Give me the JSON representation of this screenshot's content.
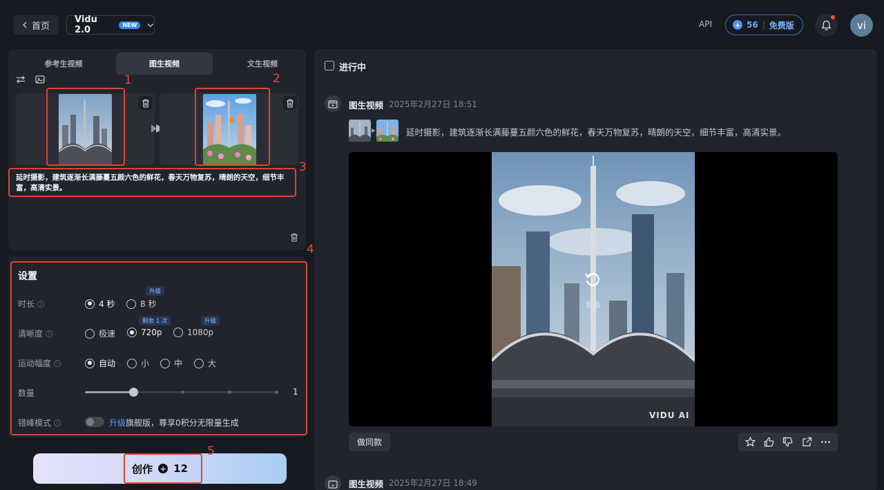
{
  "header": {
    "home_label": "首页",
    "model_name": "Vidu 2.0",
    "new_badge": "NEW",
    "api_label": "API",
    "credits": "56",
    "plan": "免费版",
    "avatar_initials": "vi"
  },
  "upload": {
    "tabs": [
      {
        "label": "参考生视频",
        "active": false
      },
      {
        "label": "图生视频",
        "active": true
      },
      {
        "label": "文生视频",
        "active": false
      }
    ],
    "prompt": "延时摄影，建筑逐渐长满藤蔓五颜六色的鲜花，春天万物复苏，晴朗的天空，细节丰富，高清实景。"
  },
  "annotations": [
    "1",
    "2",
    "3",
    "4",
    "5"
  ],
  "settings": {
    "title": "设置",
    "duration": {
      "label": "时长",
      "options": [
        "4 秒",
        "8 秒"
      ],
      "selected": "4 秒",
      "upgrade_chip": "升级"
    },
    "resolution": {
      "label": "清晰度",
      "options": [
        "极速",
        "720p",
        "1080p"
      ],
      "selected": "720p",
      "remaining_chip": "剩余 1 次",
      "upgrade_chip": "升级"
    },
    "motion": {
      "label": "运动幅度",
      "options": [
        "自动",
        "小",
        "中",
        "大"
      ],
      "selected": "自动"
    },
    "quantity": {
      "label": "数量",
      "value": "1",
      "level": 0.25
    },
    "offpeak": {
      "label": "错峰模式",
      "link": "升级",
      "text": "旗舰版，尊享0积分无限量生成",
      "enabled": false
    }
  },
  "create": {
    "label": "创作",
    "cost": "12"
  },
  "results": {
    "filter_label": "进行中",
    "task": {
      "type": "图生视频",
      "time": "2025年2月27日 18:51",
      "prompt": "延时摄影，建筑逐渐长满藤蔓五颜六色的鲜花，春天万物复苏，晴朗的天空，细节丰富，高清实景。",
      "replay_label": "重播",
      "watermark": "VIDU AI",
      "same_button": "做同款"
    },
    "next_task": {
      "type": "图生视频",
      "time": "2025年2月27日 18:49"
    }
  },
  "colors": {
    "accent": "#2f8cff",
    "annotation": "#e0442f",
    "background": "#181a21",
    "panel": "#21242c"
  }
}
